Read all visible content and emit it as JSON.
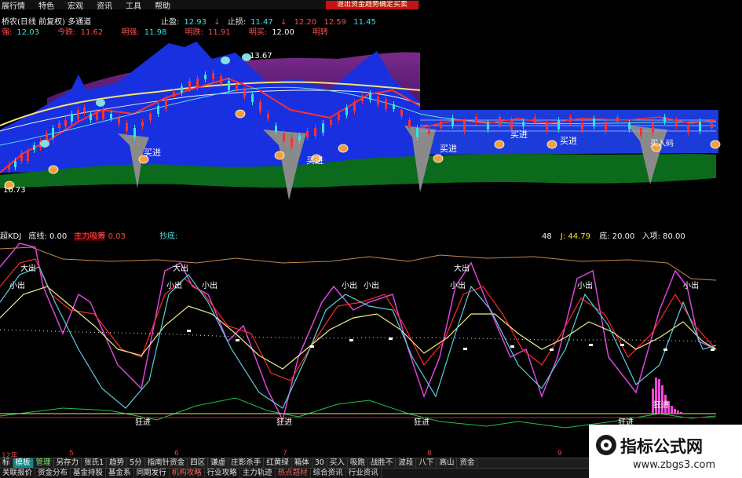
{
  "menu": [
    "展行情",
    "特色",
    "宏观",
    "资讯",
    "工具",
    "帮助"
  ],
  "stock_info": {
    "name": "桥农(日线 前复权) 多通道"
  },
  "alert_text": "退出资金趋势确定买卖",
  "row1": {
    "stop_win_label": "止盈:",
    "stop_win_value": "12.93",
    "stop_loss_label": "止损:",
    "stop_loss_value": "11.47",
    "v3": "12.20",
    "v4": "12.59",
    "v5": "11.45"
  },
  "row2": {
    "l1": "强:",
    "v1": "12.03",
    "l2": "今跌:",
    "v2": "11.62",
    "l3": "明强:",
    "v3": "11.98",
    "l4": "明跌:",
    "v4": "11.91",
    "l5": "明买:",
    "v5": "12.00",
    "l6": "明转"
  },
  "price_labels": {
    "high": "13.67",
    "low": "10.73"
  },
  "signals": {
    "buy": "买进",
    "big_out": "大出",
    "small_out": "小出",
    "crazy_in": "狂进",
    "buy_code": "买入码"
  },
  "sub_header": {
    "name": "超KDJ",
    "bottom_line": "底线: 0.00",
    "main_force": "主力吸筹",
    "main_force_value": "0.03",
    "copy_bottom": "抄底:",
    "right_1": "48",
    "right_j": "J: 44.79",
    "right_bottom": "底: 20.00",
    "right_entry": "入项: 80.00"
  },
  "time_axis": [
    "12年",
    "5",
    "6",
    "7",
    "8",
    "9"
  ],
  "tabs_row1": [
    "标",
    "模板",
    "管理",
    "另存力",
    "张氏1",
    "趋势",
    "5分",
    "指南针资金",
    "四区",
    "谦虚",
    "庄影杀手",
    "红黄绿",
    "箱体",
    "30",
    "买入",
    "吸跑",
    "战胜不",
    "波段",
    "八下",
    "高山",
    "资金"
  ],
  "tabs_row2": [
    "关联报价",
    "资金分布",
    "基金持股",
    "基金系",
    "同期发行",
    "机构攻略",
    "行业攻略",
    "主力轨迹",
    "热点题材",
    "综合资讯",
    "行业资讯"
  ],
  "watermark": {
    "title": "指标公式网",
    "url": "www.zbgs3.com"
  },
  "colors": {
    "background": "#000000",
    "channel_blue": "#1336d8",
    "channel_green": "#0a6e1c",
    "channel_purple": "#6a1a7a",
    "rise": "#ff3232",
    "fall": "#33e5e5",
    "kdj_k": "#ff2a2a",
    "kdj_d": "#f3ec86",
    "kdj_j": "#dd44dd"
  }
}
